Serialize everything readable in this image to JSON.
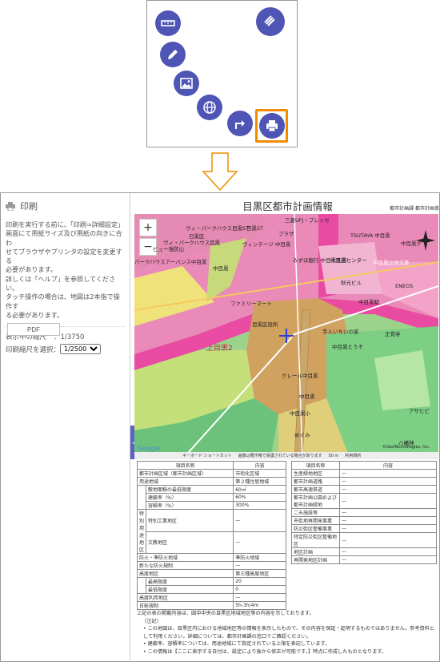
{
  "menu": {
    "items": [
      {
        "name": "ruler",
        "label": ""
      },
      {
        "name": "pencil",
        "label": ""
      },
      {
        "name": "image",
        "label": ""
      },
      {
        "name": "globe",
        "label": ""
      },
      {
        "name": "arrow",
        "label": ""
      },
      {
        "name": "printer",
        "label": ""
      },
      {
        "name": "menu",
        "label": ""
      }
    ],
    "accent": "#4e55b5",
    "highlight": "#f08c00"
  },
  "sidebar": {
    "header": "印刷",
    "description_lines": [
      "印刷を実行する前に、「印刷⇒詳細設定」",
      "画面にて用紙サイズ及び用紙の向きに合わ",
      "せてブラウザやプリンタの設定を変更する",
      "必要があります。",
      "詳しくは「ヘルプ」を参照してください。",
      "タッチ操作の場合は、地図は2本指で操作す",
      "る必要があります。"
    ],
    "display_scale_label": "表示中の縮尺",
    "display_scale_value": "：1/3750",
    "print_scale_label": "印刷縮尺を選択：",
    "print_scale_value": "1/2500",
    "pdf_label": "PDF"
  },
  "main": {
    "title": "目黒区都市計画情報",
    "dept": "都市計画課 都市計画係",
    "map": {
      "zoom_in": "+",
      "zoom_out": "−",
      "labels": [
        "三菱UFJ・プレッセ",
        "ヴィ・パークハウス目黒ST",
        "目黒ST",
        "ブラザ",
        "日黒区",
        "ヴィ・パークハウス目黒",
        "ヴィンテージ 中目黒",
        "TSUTAYA 中目黒",
        "中目黒ゲ",
        "ビュー強防山",
        "みずほ銀行 中目黒支店",
        "中目黒センター",
        "中目黒立体交差",
        "パークハウスアーバンス中目黒",
        "ENEOS",
        "秋元ビル",
        "中目黒",
        "中目黒駅",
        "ファミリーマート",
        "目黒区役所",
        "手入いちいの家",
        "正覚寺",
        "上目黒2",
        "中目黒とうそ",
        "クレール中目黒",
        "中目黒",
        "中目黒小",
        "めぐみ",
        "アサヒビ",
        "八幡神",
        "Google",
        "©GeoTechnologies, Inc."
      ],
      "footer": [
        "キーボード ショートカット",
        "画像は著作権で保護されている場合があります",
        "50 m",
        "利用規約"
      ]
    }
  },
  "table_left": {
    "headers": [
      "項目名称",
      "内容"
    ],
    "rows": [
      [
        "都市計画区域（都市計画区域）",
        "市街化区域"
      ],
      [
        "用途地域",
        "第２種住居地域"
      ],
      [
        "敷地面積の最低限度",
        "60㎡"
      ],
      [
        "建蔽率（%）",
        "60%"
      ],
      [
        "容積率（%）",
        "300%"
      ],
      [
        "特別用途地区",
        "特別工業地区",
        "—"
      ],
      [
        "",
        "文教地区",
        "—"
      ],
      [
        "防火・準防火地域",
        "準防火地域"
      ],
      [
        "新たな防火規制",
        "—"
      ],
      [
        "高度地区",
        "第三種高度地区"
      ],
      [
        "最高限度",
        "20"
      ],
      [
        "最低限度",
        "0"
      ],
      [
        "高度利用地区",
        "—"
      ],
      [
        "日影規制",
        "5h-3h/4m"
      ]
    ]
  },
  "table_right": {
    "headers": [
      "項目名称",
      "内容"
    ],
    "rows": [
      [
        "生産緑地地区",
        "—"
      ],
      [
        "都市計画道路",
        "—"
      ],
      [
        "都市高速鉄道",
        "—"
      ],
      [
        "都市計画公園および都市計画緑地",
        "—"
      ],
      [
        "ごみ施設等",
        "—"
      ],
      [
        "市街地再開発事業",
        "—"
      ],
      [
        "防災街区整備事業",
        "—"
      ],
      [
        "特定防災街区整備地区",
        "—"
      ],
      [
        "地区計画",
        "—"
      ],
      [
        "再開発地区計画",
        "—"
      ]
    ]
  },
  "notes": {
    "intro": "上記の表の掲載内容は、図中中央の目黒区地域地区等の内容を示しております。",
    "label": "（注記）",
    "bullets": [
      "この地図は、目黒区内における地域地区等の情報を表示したもので、その内容を保証・証明するものではありません。参考資料として利用ください。詳細については、都市計画課の窓口でご確認ください。",
      "建蔽率、容積率については、用途地域にて指定されている上限を表記しています。",
      "この情報は【ここに表示する日付は、設定により後から修正が可能です。】時点に作成したものとなります。"
    ]
  }
}
